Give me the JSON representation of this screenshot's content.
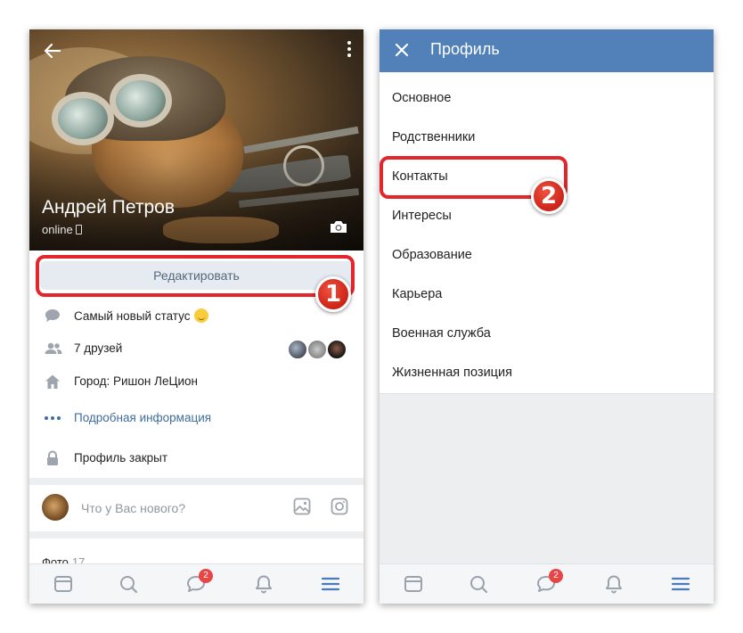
{
  "left_screen": {
    "profile": {
      "name": "Андрей Петров",
      "status_text": "online"
    },
    "edit_button_label": "Редактировать",
    "info": {
      "status": "Самый новый статус",
      "friends": "7 друзей",
      "city": "Город: Ришон ЛеЦион",
      "more_info": "Подробная информация",
      "privacy": "Профиль закрыт"
    },
    "composer": {
      "placeholder": "Что у Вас нового?"
    },
    "photos": {
      "label": "Фото",
      "count": "17"
    }
  },
  "right_screen": {
    "title": "Профиль",
    "menu_items": [
      "Основное",
      "Родственники",
      "Контакты",
      "Интересы",
      "Образование",
      "Карьера",
      "Военная служба",
      "Жизненная позиция"
    ]
  },
  "tabbar": {
    "tabs": [
      "news-icon",
      "search-icon",
      "messages-icon",
      "notifications-icon",
      "menu-icon"
    ],
    "messages_badge": "2",
    "active_tab": "menu-icon"
  },
  "annotations": {
    "step1": "1",
    "step2": "2"
  },
  "colors": {
    "accent": "#5181b8",
    "highlight": "#e3262b",
    "link": "#3f6d9e",
    "button_bg": "#e5ebf1"
  }
}
